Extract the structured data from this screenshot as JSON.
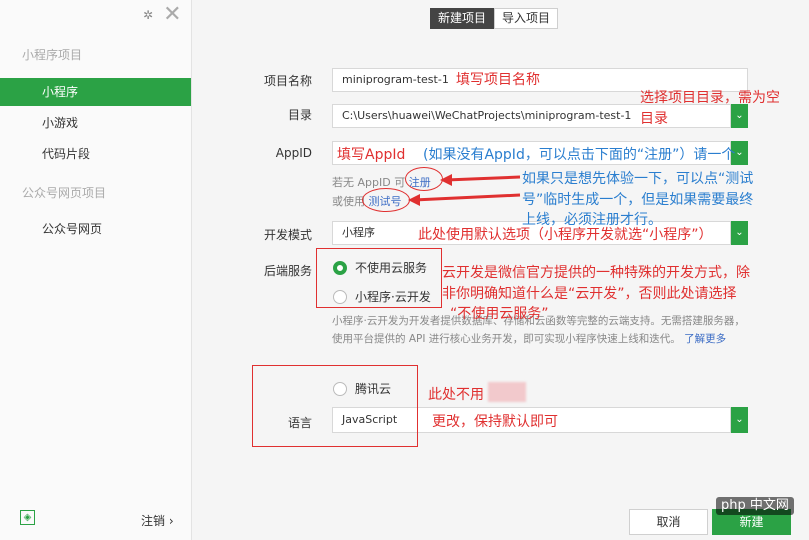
{
  "sidebar": {
    "section1_title": "小程序项目",
    "items1": [
      "小程序",
      "小游戏",
      "代码片段"
    ],
    "section2_title": "公众号网页项目",
    "items2": [
      "公众号网页"
    ],
    "logout": "注销 ›"
  },
  "tabs": [
    "新建项目",
    "导入项目"
  ],
  "form": {
    "name_label": "项目名称",
    "name_value": "miniprogram-test-1",
    "dir_label": "目录",
    "dir_value": "C:\\Users\\huawei\\WeChatProjects\\miniprogram-test-1",
    "appid_label": "AppID",
    "appid_hint_prefix": "若无 AppID 可",
    "appid_hint_link": "注册",
    "appid_hint2_prefix": "或使用",
    "appid_hint2_link": "测试号",
    "mode_label": "开发模式",
    "mode_value": "小程序",
    "backend_label": "后端服务",
    "backend_opt1": "不使用云服务",
    "backend_opt2": "小程序·云开发",
    "cloud_desc": "小程序·云开发为开发者提供数据库、存储和云函数等完整的云端支持。无需搭建服务器，使用平台提供的 API 进行核心业务开发，即可实现小程序快速上线和迭代。",
    "cloud_link": "了解更多",
    "tencent_opt": "腾讯云",
    "lang_label": "语言",
    "lang_value": "JavaScript"
  },
  "buttons": {
    "cancel": "取消",
    "create": "新建"
  },
  "annotations": {
    "a1": "填写项目名称",
    "a2_line1": "选择项目目录，需为空",
    "a2_line2": "目录",
    "a3": "填写AppId",
    "a4_line1": "(如果没有AppId，可以点击下面的“注册”）请一个",
    "a4_line2": "如果只是想先体验一下，可以点“测试",
    "a4_line3": "号”临时生成一个，但是如果需要最终",
    "a4_line4": "上线，必须注册才行。",
    "a5": "此处使用默认选项（小程序开发就选“小程序”）",
    "a6_line1": "云开发是微信官方提供的一种特殊的开发方式，除",
    "a6_line2": "非你明确知道什么是“云开发”，否则此处请选择",
    "a6_line3": "“不使用云服务”",
    "a7": "此处不用",
    "a8": "更改，保持默认即可"
  },
  "watermark": "php 中文网",
  "colors": {
    "accent": "#2ba245",
    "annotation_red": "#e03030",
    "annotation_blue": "#2a7ecf"
  }
}
